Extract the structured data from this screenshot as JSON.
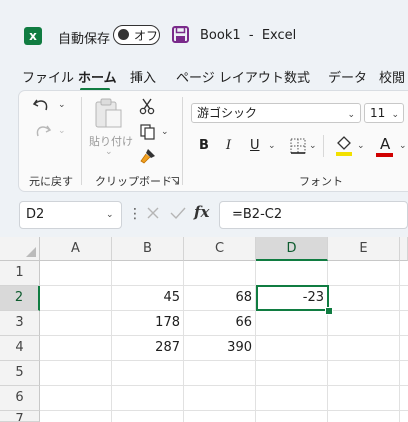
{
  "titlebar": {
    "app_icon_letter": "x",
    "autosave_label": "自動保存",
    "autosave_state": "オフ",
    "document_title": "Book1  -  Excel"
  },
  "tabs": [
    "ファイル",
    "ホーム",
    "挿入",
    "ページ レイアウト",
    "数式",
    "データ",
    "校閲"
  ],
  "active_tab": "ホーム",
  "ribbon": {
    "undo_group_label": "元に戻す",
    "paste_label": "貼り付け",
    "clipboard_group_label": "クリップボード",
    "font_name": "游ゴシック",
    "font_size": "11",
    "bold": "B",
    "italic": "I",
    "underline": "U",
    "font_color_letter": "A",
    "font_group_label": "フォント",
    "fill_color": "#f2e000",
    "font_color": "#d00000"
  },
  "formula_bar": {
    "name_box": "D2",
    "fx_label": "fx",
    "formula": "=B2-C2"
  },
  "sheet": {
    "columns": [
      "A",
      "B",
      "C",
      "D",
      "E"
    ],
    "rows": [
      "1",
      "2",
      "3",
      "4",
      "5",
      "6",
      "7"
    ],
    "cells": {
      "B2": "45",
      "C2": "68",
      "D2": "-23",
      "B3": "178",
      "C3": "66",
      "B4": "287",
      "C4": "390"
    },
    "selected_cell": "D2"
  },
  "colors": {
    "accent": "#107c41"
  }
}
